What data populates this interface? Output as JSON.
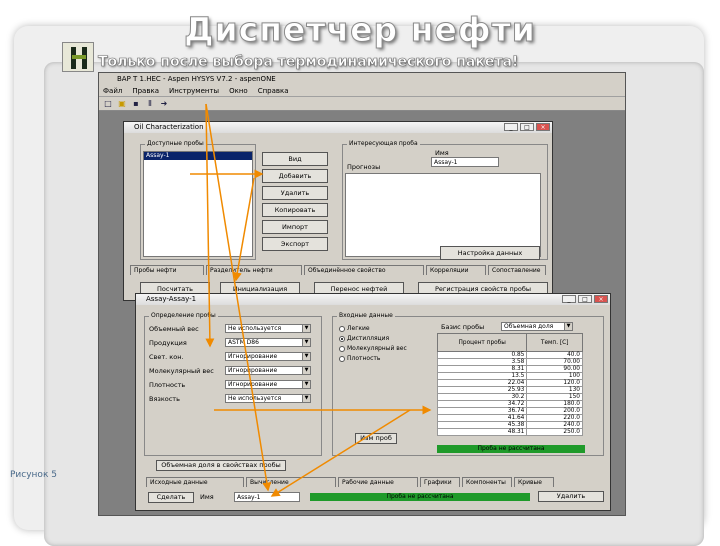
{
  "slide": {
    "title": "Диспетчер нефти",
    "subtitle": "Только после выбора термодинамического пакета!",
    "caption": "Рисунок 5"
  },
  "app": {
    "title": "ВАР Т 1.НЕС - Aspen HYSYS V7.2 - aspenONE",
    "menu": [
      "Файл",
      "Правка",
      "Инструменты",
      "Окно",
      "Справка"
    ]
  },
  "oil_char": {
    "title": "Oil Characterization",
    "assays_group": "Доступные пробы",
    "assay_item": "Assay-1",
    "buttons": [
      "Вид",
      "Добавить",
      "Удалить",
      "Копировать",
      "Импорт",
      "Экспорт"
    ],
    "cut_group": "Интересующая проба",
    "name_label": "Имя",
    "name_value": "Assay-1",
    "results_label": "Прогнозы",
    "settings_button": "Настройка данных",
    "tabs": [
      "Пробы нефти",
      "Разделитель нефти",
      "Объединённое свойство",
      "Корреляции",
      "Сопоставление"
    ],
    "bottom_buttons": [
      "Посчитать",
      "Инициализация",
      "Перенос нефтей",
      "Регистрация свойств пробы"
    ]
  },
  "assay": {
    "title": "Assay-Assay-1",
    "def_group": "Определение пробы",
    "fields": [
      {
        "label": "Объемный вес",
        "value": "Не используется"
      },
      {
        "label": "Продукция",
        "value": "ASTM D86"
      },
      {
        "label": "Свет. кон.",
        "value": "Игнорирование"
      },
      {
        "label": "Молекулярный вес",
        "value": "Игнорирование"
      },
      {
        "label": "Плотность",
        "value": "Игнорирование"
      },
      {
        "label": "Вязкость",
        "value": "Не используется"
      }
    ],
    "input_group": "Входные данные",
    "radios": [
      "Легкие",
      "Дистилляция",
      "Молекулярный вес",
      "Плотность"
    ],
    "radio_selected": 1,
    "basis_label": "Базис пробы",
    "basis_value": "Объемная доля",
    "table_headers": [
      "Процент пробы",
      "Темп. [C]"
    ],
    "table_rows": [
      [
        "0.85",
        "40.0"
      ],
      [
        "3.58",
        "70.00"
      ],
      [
        "8.31",
        "90.00"
      ],
      [
        "13.5",
        "100"
      ],
      [
        "22.04",
        "120.0"
      ],
      [
        "25.93",
        "130"
      ],
      [
        "30.2",
        "150"
      ],
      [
        "34.72",
        "180.0"
      ],
      [
        "36.74",
        "200.0"
      ],
      [
        "41.64",
        "220.0"
      ],
      [
        "45.38",
        "240.0"
      ],
      [
        "48.31",
        "250.0"
      ]
    ],
    "edit_button": "Изм проб",
    "green_status": "Проба не рассчитана",
    "options_bar": "Объемная доля в свойствах пробы",
    "tabs": [
      "Исходные данные",
      "Вычисление",
      "Рабочие данные",
      "Графики",
      "Компоненты",
      "Кривые"
    ],
    "calc_button": "Сделать",
    "name_label": "Имя",
    "name_value": "Assay-1",
    "status_bar": "Проба не рассчитана",
    "delete_button": "Удалить"
  }
}
